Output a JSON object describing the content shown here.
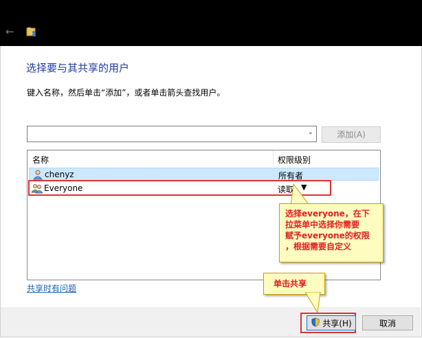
{
  "window": {
    "back_icon": "back-arrow-icon",
    "app_icon": "shared-folder-icon"
  },
  "dialog": {
    "heading": "选择要与其共享的用户",
    "instruction": "键入名称，然后单击“添加”，或者单击箭头查找用户。",
    "combo_value": "",
    "add_button": "添加(A)",
    "columns": {
      "name": "名称",
      "permission": "权限级别"
    },
    "rows": [
      {
        "name": "chenyz",
        "permission": "所有者",
        "icon": "user-icon",
        "selected": true
      },
      {
        "name": "Everyone",
        "permission": "读取",
        "icon": "group-users-icon",
        "selected": false
      }
    ],
    "help_link": "共享时有问题",
    "share_button": "共享(H)",
    "cancel_button": "取消"
  },
  "annotations": {
    "callout_1": [
      "选择everyone，在下",
      "拉菜单中选择你需要",
      "赋予everyone的权限",
      "，根据需要自定义"
    ],
    "callout_2": "单击共享"
  },
  "colors": {
    "heading": "#1e3aa8",
    "link": "#1a5fb4",
    "selection": "#cce8ff",
    "annotation_red": "#e02020",
    "callout_bg": "#fffcbf"
  }
}
